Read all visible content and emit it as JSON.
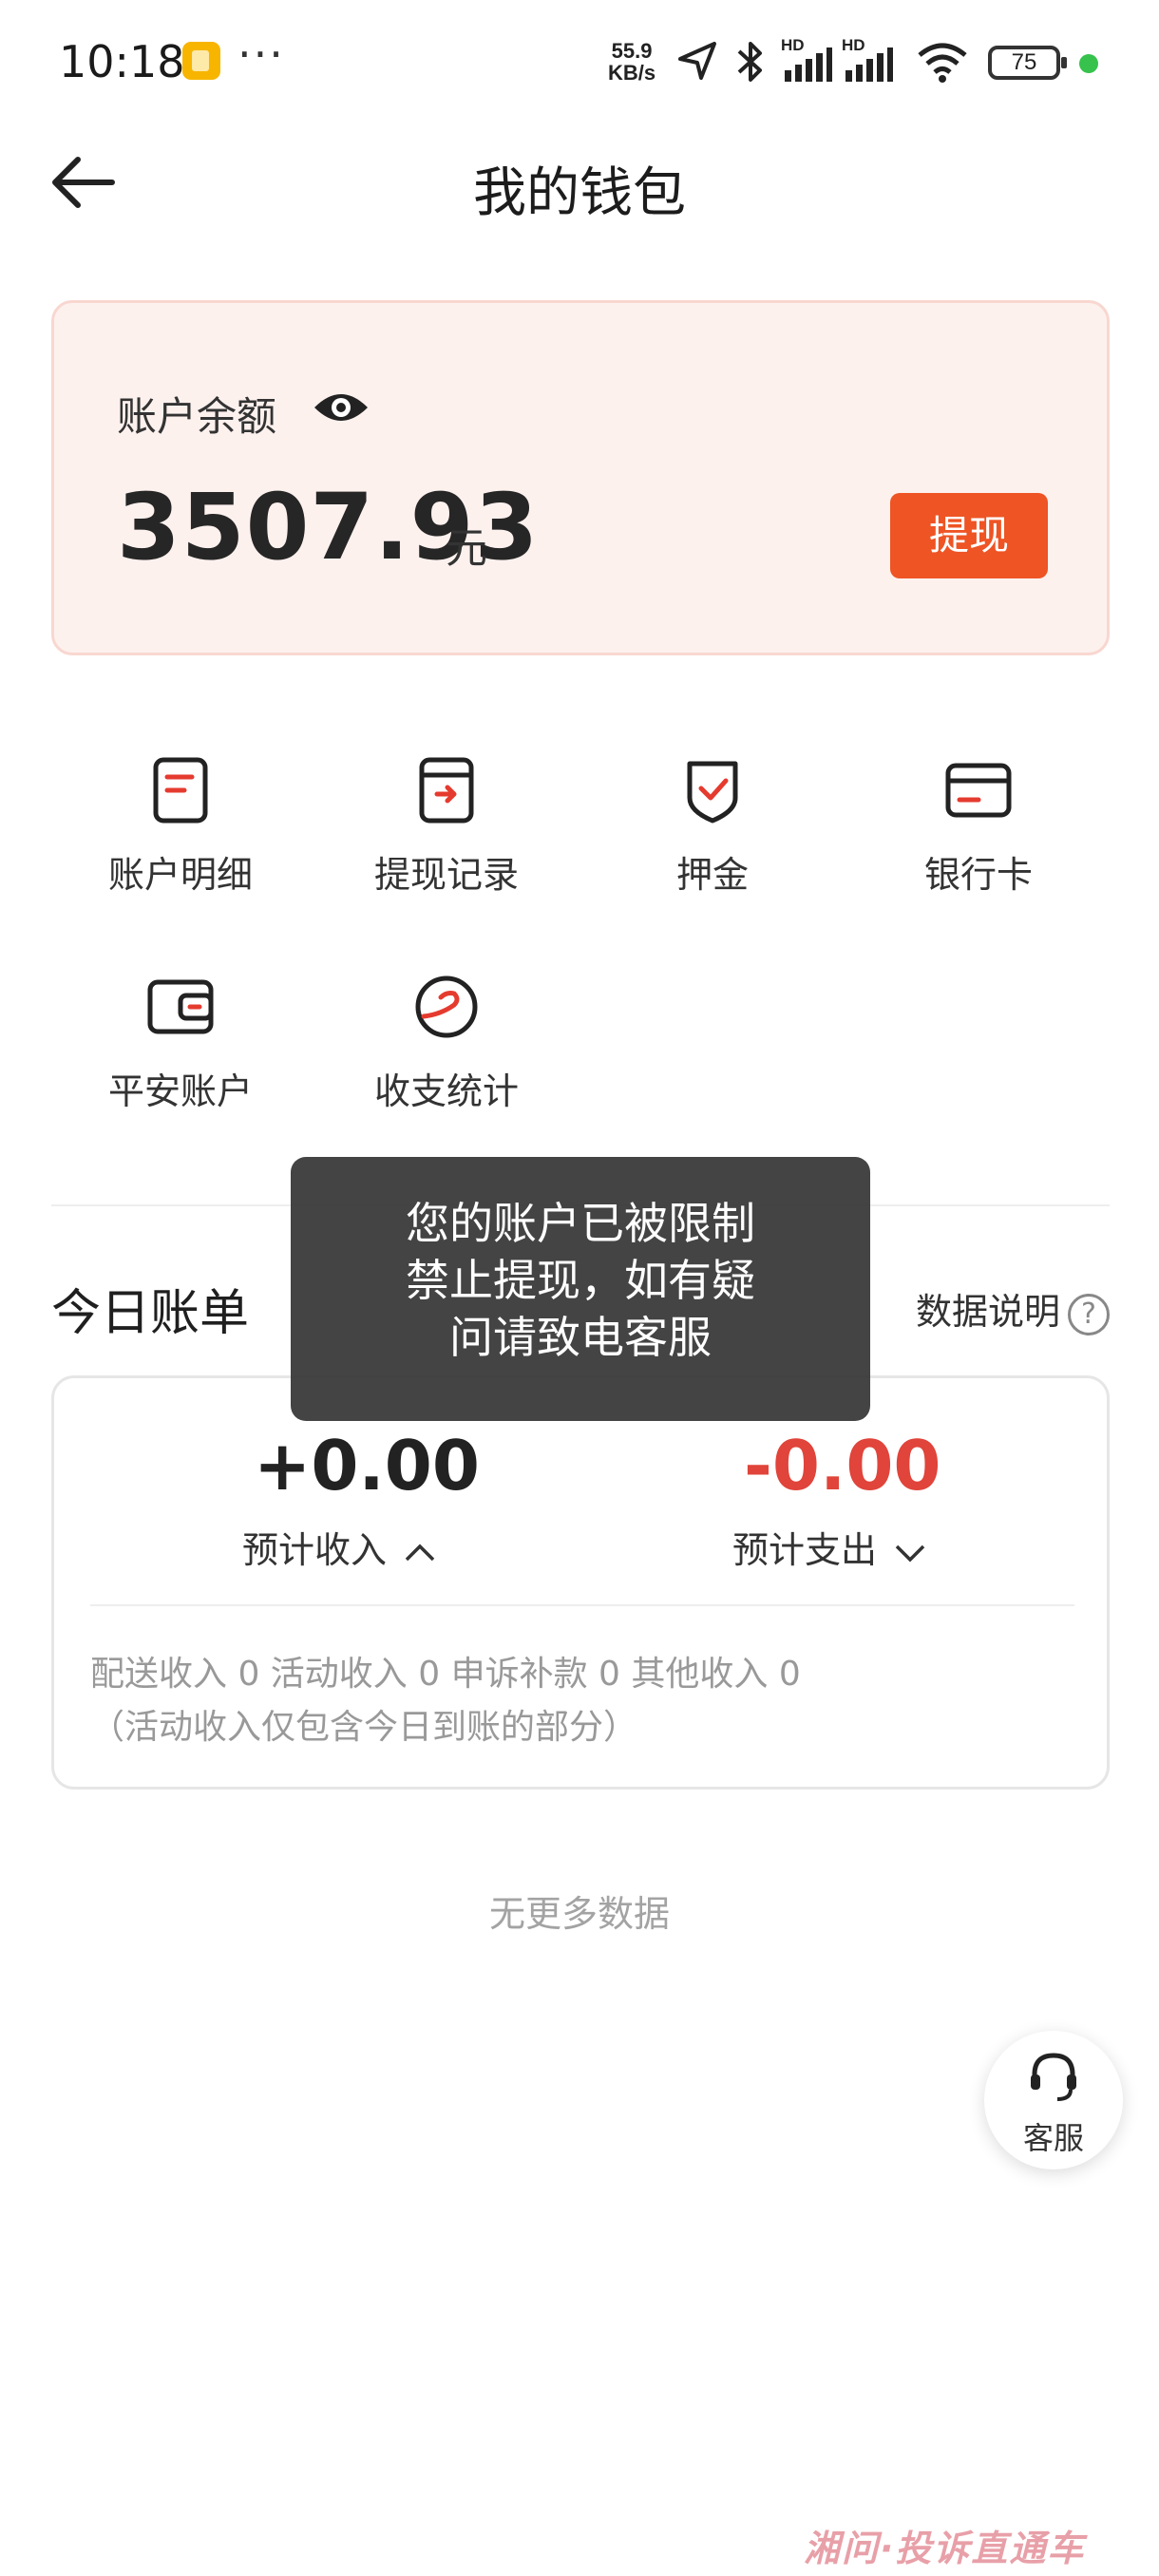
{
  "status_bar": {
    "time": "10:18",
    "network_speed_value": "55.9",
    "network_speed_unit": "KB/s",
    "signal_tag_1": "HD",
    "signal_tag_2": "HD",
    "battery": "75",
    "icons": [
      "app-notification-icon",
      "more-dots-icon",
      "location-arrow-icon",
      "bluetooth-icon",
      "signal-icon",
      "wifi-icon",
      "battery-icon",
      "active-dot-icon"
    ]
  },
  "header": {
    "title": "我的钱包",
    "back_icon": "arrow-left-icon"
  },
  "balance": {
    "label": "账户余额",
    "value": "3507.93",
    "unit": "元",
    "withdraw_label": "提现",
    "accent": "#ee5424",
    "card_bg": "#fdf1ee"
  },
  "grid": {
    "items": [
      {
        "label": "账户明细",
        "icon": "account-detail-icon"
      },
      {
        "label": "提现记录",
        "icon": "withdraw-record-icon"
      },
      {
        "label": "押金",
        "icon": "deposit-shield-icon"
      },
      {
        "label": "银行卡",
        "icon": "bank-card-icon"
      },
      {
        "label": "平安账户",
        "icon": "wallet-icon"
      },
      {
        "label": "收支统计",
        "icon": "statistics-icon"
      }
    ]
  },
  "today": {
    "title": "今日账单",
    "explain_label": "数据说明",
    "help_glyph": "?",
    "income_value": "+0.00",
    "income_label": "预计收入",
    "expense_value": "-0.00",
    "expense_label": "预计支出",
    "detail_line1": "配送收入 0 活动收入 0 申诉补款 0 其他收入 0",
    "detail_line2": "（活动收入仅包含今日到账的部分）",
    "expense_color": "#e0443a"
  },
  "no_more": "无更多数据",
  "toast": {
    "line1": "您的账户已被限制",
    "line2": "禁止提现，如有疑",
    "line3": "问请致电客服"
  },
  "service": {
    "label": "客服",
    "icon": "headset-icon"
  },
  "watermark": "湘问·投诉直通车"
}
